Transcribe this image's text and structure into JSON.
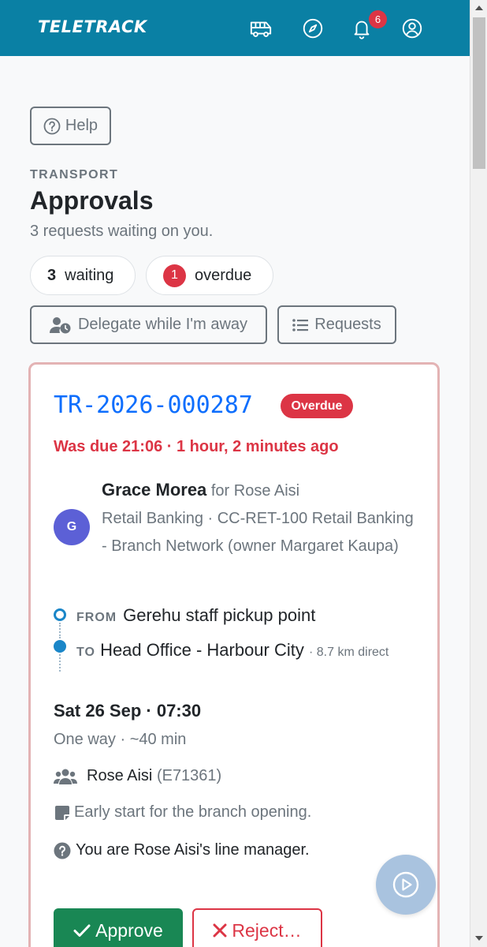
{
  "navbar": {
    "brand": "TELETRACK",
    "notification_count": "6",
    "icons": [
      "bus-icon",
      "compass-icon",
      "bell-icon",
      "user-circle-icon"
    ]
  },
  "colors": {
    "navbar": "#0a80a4",
    "primary": "#0d6efd",
    "danger": "#dc3545",
    "success": "#198754",
    "avatar": "#5c60d6",
    "card_border": "#e3b3b4"
  },
  "page": {
    "help_label": "Help",
    "eyebrow": "TRANSPORT",
    "title": "Approvals",
    "subtitle": "3 requests waiting on you.",
    "waiting_count": "3",
    "waiting_label": "waiting",
    "overdue_count": "1",
    "overdue_label": "overdue",
    "delegate_label": "Delegate while I'm away",
    "requests_label": "Requests"
  },
  "request": {
    "ref": "TR-2026-000287",
    "status": "Overdue",
    "due_text": "Was due 21:06 · 1 hour, 2 minutes ago",
    "avatar_initial": "G",
    "requester_name": "Grace Morea",
    "on_behalf": "for Rose Aisi",
    "department": "Retail Banking · CC-RET-100 Retail Banking - Branch Network (owner Margaret Kaupa)",
    "from_label": "FROM",
    "from": "Gerehu staff pickup point",
    "to_label": "TO",
    "to": "Head Office - Harbour City",
    "distance": "· 8.7 km direct",
    "date_time": "Sat 26 Sep · 07:30",
    "trip": "One way · ~40 min",
    "passenger_name": "Rose Aisi",
    "passenger_id": "(E71361)",
    "note": "Early start for the branch opening.",
    "manager_note": "You are Rose Aisi's line manager.",
    "approve_label": "Approve",
    "reject_label": "Reject…"
  }
}
